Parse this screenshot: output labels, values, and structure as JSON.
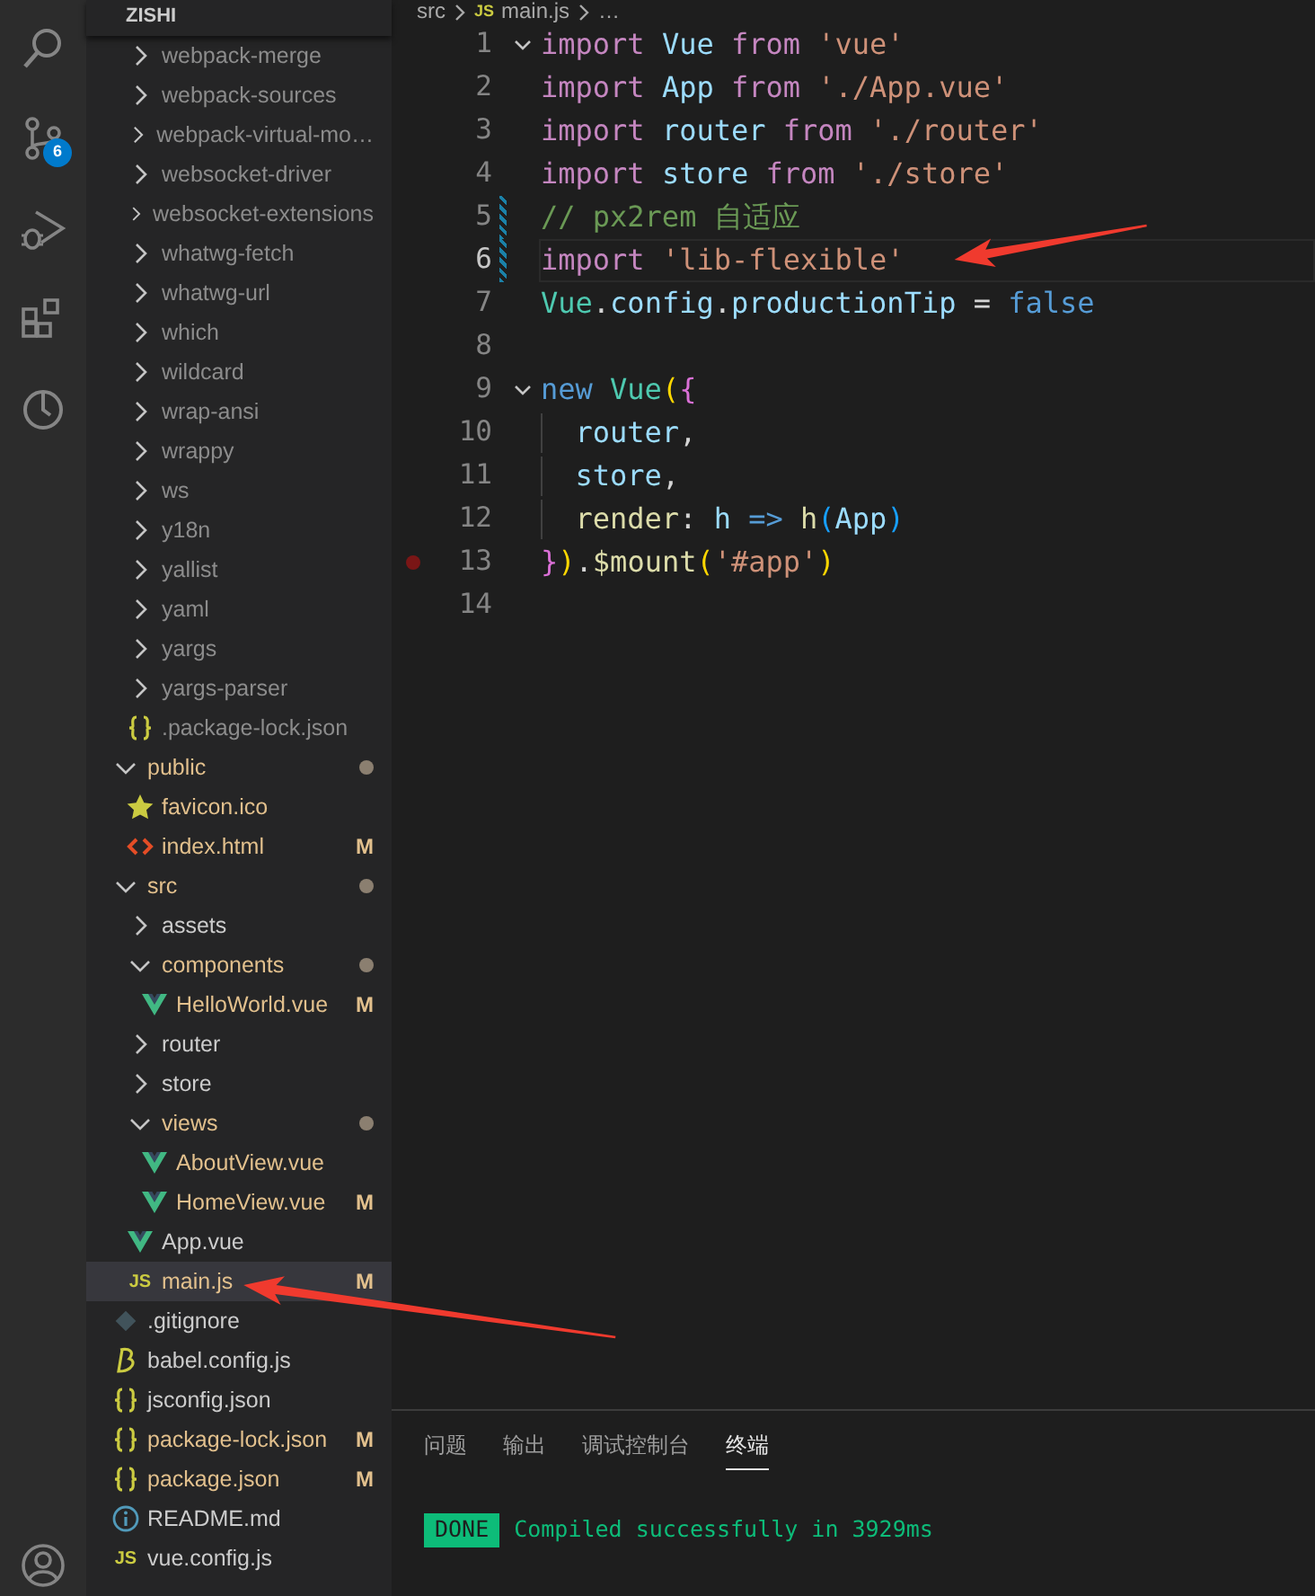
{
  "activity_bar": {
    "items": [
      {
        "kind": "search"
      },
      {
        "kind": "source-control",
        "badge": "6"
      },
      {
        "kind": "debug"
      },
      {
        "kind": "extensions"
      },
      {
        "kind": "timeline"
      }
    ],
    "account": {
      "kind": "account"
    }
  },
  "explorer": {
    "title": "ZISHI",
    "items": [
      {
        "kind": "offscreen",
        "children": [
          {
            "label": "webpack-merge",
            "kind": "folder",
            "expanded": false,
            "dimmed": true,
            "selected": false
          },
          {
            "label": "webpack-sources",
            "kind": "folder",
            "expanded": false,
            "dimmed": true,
            "selected": false
          },
          {
            "label": "webpack-virtual-mo…",
            "kind": "folder",
            "expanded": false,
            "dimmed": true,
            "selected": false
          },
          {
            "label": "websocket-driver",
            "kind": "folder",
            "expanded": false,
            "dimmed": true,
            "selected": false
          },
          {
            "label": "websocket-extensions",
            "kind": "folder",
            "expanded": false,
            "dimmed": true,
            "selected": false
          },
          {
            "label": "whatwg-fetch",
            "kind": "folder",
            "expanded": false,
            "dimmed": true,
            "selected": false
          },
          {
            "label": "whatwg-url",
            "kind": "folder",
            "expanded": false,
            "dimmed": true,
            "selected": false
          },
          {
            "label": "which",
            "kind": "folder",
            "expanded": false,
            "dimmed": true,
            "selected": false
          },
          {
            "label": "wildcard",
            "kind": "folder",
            "expanded": false,
            "dimmed": true,
            "selected": false
          },
          {
            "label": "wrap-ansi",
            "kind": "folder",
            "expanded": false,
            "dimmed": true,
            "selected": false
          },
          {
            "label": "wrappy",
            "kind": "folder",
            "expanded": false,
            "dimmed": true,
            "selected": false
          },
          {
            "label": "ws",
            "kind": "folder",
            "expanded": false,
            "dimmed": true,
            "selected": false
          },
          {
            "label": "y18n",
            "kind": "folder",
            "expanded": false,
            "dimmed": true,
            "selected": false
          },
          {
            "label": "yallist",
            "kind": "folder",
            "expanded": false,
            "dimmed": true,
            "selected": false
          },
          {
            "label": "yaml",
            "kind": "folder",
            "expanded": false,
            "dimmed": true,
            "selected": false
          },
          {
            "label": "yargs",
            "kind": "folder",
            "expanded": false,
            "dimmed": true,
            "selected": false
          },
          {
            "label": "yargs-parser",
            "kind": "folder",
            "expanded": false,
            "dimmed": true,
            "selected": false
          },
          {
            "label": ".package-lock.json",
            "kind": "json",
            "dimmed": true,
            "selected": false
          }
        ]
      },
      {
        "label": "public",
        "kind": "folder",
        "expanded": true,
        "dimmed": false,
        "modified": true,
        "dot": true,
        "selected": false,
        "children": [
          {
            "label": "favicon.ico",
            "kind": "star",
            "dimmed": false,
            "modified": true,
            "selected": false
          },
          {
            "label": "index.html",
            "kind": "html",
            "dimmed": false,
            "modified": true,
            "badge": "M",
            "selected": false
          }
        ]
      },
      {
        "label": "src",
        "kind": "folder",
        "expanded": true,
        "dimmed": false,
        "modified": true,
        "dot": true,
        "selected": false,
        "children": [
          {
            "label": "assets",
            "kind": "folder",
            "expanded": false,
            "dimmed": false,
            "modified": false,
            "selected": false
          },
          {
            "label": "components",
            "kind": "folder",
            "expanded": true,
            "dimmed": false,
            "modified": true,
            "dot": true,
            "selected": false,
            "children": [
              {
                "label": "HelloWorld.vue",
                "kind": "vue",
                "dimmed": false,
                "modified": true,
                "badge": "M",
                "selected": false
              }
            ]
          },
          {
            "label": "router",
            "kind": "folder",
            "expanded": false,
            "dimmed": false,
            "modified": false,
            "selected": false
          },
          {
            "label": "store",
            "kind": "folder",
            "expanded": false,
            "dimmed": false,
            "modified": false,
            "selected": false
          },
          {
            "label": "views",
            "kind": "folder",
            "expanded": true,
            "dimmed": false,
            "modified": true,
            "dot": true,
            "selected": false,
            "children": [
              {
                "label": "AboutView.vue",
                "kind": "vue",
                "dimmed": false,
                "modified": true,
                "selected": false
              },
              {
                "label": "HomeView.vue",
                "kind": "vue",
                "dimmed": false,
                "modified": true,
                "badge": "M",
                "selected": false
              }
            ]
          },
          {
            "label": "App.vue",
            "kind": "vue",
            "dimmed": false,
            "modified": false,
            "selected": false
          },
          {
            "label": "main.js",
            "kind": "js",
            "icon_text": "JS",
            "dimmed": false,
            "modified": true,
            "badge": "M",
            "selected": true,
            "arrow": true
          }
        ]
      },
      {
        "label": ".gitignore",
        "kind": "git",
        "dimmed": false,
        "modified": false,
        "selected": false
      },
      {
        "label": "babel.config.js",
        "kind": "babel",
        "dimmed": false,
        "modified": false,
        "selected": false
      },
      {
        "label": "jsconfig.json",
        "kind": "json",
        "dimmed": false,
        "modified": false,
        "selected": false
      },
      {
        "label": "package-lock.json",
        "kind": "json",
        "dimmed": false,
        "modified": true,
        "badge": "M",
        "selected": false
      },
      {
        "label": "package.json",
        "kind": "json",
        "dimmed": false,
        "modified": true,
        "badge": "M",
        "selected": false
      },
      {
        "label": "README.md",
        "kind": "info",
        "dimmed": false,
        "modified": false,
        "selected": false
      },
      {
        "label": "vue.config.js",
        "kind": "js",
        "icon_text": "JS",
        "dimmed": false,
        "modified": false,
        "selected": false
      }
    ]
  },
  "breadcrumb": [
    {
      "label": "src",
      "kind": "folder"
    },
    {
      "label": "main.js",
      "kind": "js",
      "icon_text": "JS"
    },
    {
      "label": "…",
      "kind": "more"
    }
  ],
  "editor": {
    "lines": [
      {
        "number": "1",
        "fold": true,
        "current": false,
        "changed": false,
        "breakpoint": false,
        "tokens": [
          {
            "text": "import ",
            "kind": "keyword"
          },
          {
            "text": "Vue ",
            "kind": "variable"
          },
          {
            "text": "from ",
            "kind": "keyword"
          },
          {
            "text": "'vue'",
            "kind": "string"
          }
        ]
      },
      {
        "number": "2",
        "fold": false,
        "current": false,
        "changed": false,
        "breakpoint": false,
        "tokens": [
          {
            "text": "import ",
            "kind": "keyword"
          },
          {
            "text": "App ",
            "kind": "variable"
          },
          {
            "text": "from ",
            "kind": "keyword"
          },
          {
            "text": "'./App.vue'",
            "kind": "string"
          }
        ]
      },
      {
        "number": "3",
        "fold": false,
        "current": false,
        "changed": false,
        "breakpoint": false,
        "tokens": [
          {
            "text": "import ",
            "kind": "keyword"
          },
          {
            "text": "router ",
            "kind": "variable"
          },
          {
            "text": "from ",
            "kind": "keyword"
          },
          {
            "text": "'./router'",
            "kind": "string"
          }
        ]
      },
      {
        "number": "4",
        "fold": false,
        "current": false,
        "changed": false,
        "breakpoint": false,
        "tokens": [
          {
            "text": "import ",
            "kind": "keyword"
          },
          {
            "text": "store ",
            "kind": "variable"
          },
          {
            "text": "from ",
            "kind": "keyword"
          },
          {
            "text": "'./store'",
            "kind": "string"
          }
        ]
      },
      {
        "number": "5",
        "fold": false,
        "current": false,
        "changed": true,
        "breakpoint": false,
        "tokens": [
          {
            "text": "// px2rem 自适应",
            "kind": "comment"
          }
        ]
      },
      {
        "number": "6",
        "fold": false,
        "current": true,
        "changed": true,
        "breakpoint": false,
        "arrow": true,
        "tokens": [
          {
            "text": "import ",
            "kind": "keyword"
          },
          {
            "text": "'lib-flexible'",
            "kind": "string"
          }
        ]
      },
      {
        "number": "7",
        "fold": false,
        "current": false,
        "changed": false,
        "breakpoint": false,
        "tokens": [
          {
            "text": "Vue",
            "kind": "class"
          },
          {
            "text": ".",
            "kind": "plain"
          },
          {
            "text": "config",
            "kind": "variable"
          },
          {
            "text": ".",
            "kind": "plain"
          },
          {
            "text": "productionTip",
            "kind": "variable"
          },
          {
            "text": " = ",
            "kind": "plain"
          },
          {
            "text": "false",
            "kind": "storage"
          }
        ]
      },
      {
        "number": "8",
        "fold": false,
        "current": false,
        "changed": false,
        "breakpoint": false
      },
      {
        "number": "9",
        "fold": true,
        "current": false,
        "changed": false,
        "breakpoint": false,
        "tokens": [
          {
            "text": "new ",
            "kind": "storage"
          },
          {
            "text": "Vue",
            "kind": "class"
          },
          {
            "text": "(",
            "kind": "bracket1"
          },
          {
            "text": "{",
            "kind": "bracket2"
          }
        ]
      },
      {
        "number": "10",
        "fold": false,
        "current": false,
        "changed": false,
        "breakpoint": false,
        "tokens": [
          {
            "text": "  router",
            "kind": "variable"
          },
          {
            "text": ",",
            "kind": "plain"
          }
        ]
      },
      {
        "number": "11",
        "fold": false,
        "current": false,
        "changed": false,
        "breakpoint": false,
        "tokens": [
          {
            "text": "  store",
            "kind": "variable"
          },
          {
            "text": ",",
            "kind": "plain"
          }
        ]
      },
      {
        "number": "12",
        "fold": false,
        "current": false,
        "changed": false,
        "breakpoint": false,
        "tokens": [
          {
            "text": "  render",
            "kind": "function"
          },
          {
            "text": ": ",
            "kind": "plain"
          },
          {
            "text": "h ",
            "kind": "variable"
          },
          {
            "text": "=> ",
            "kind": "storage"
          },
          {
            "text": "h",
            "kind": "function"
          },
          {
            "text": "(",
            "kind": "bracket3"
          },
          {
            "text": "App",
            "kind": "variable"
          },
          {
            "text": ")",
            "kind": "bracket3"
          }
        ]
      },
      {
        "number": "13",
        "fold": false,
        "current": false,
        "changed": false,
        "breakpoint": true,
        "tokens": [
          {
            "text": "}",
            "kind": "bracket2"
          },
          {
            "text": ")",
            "kind": "bracket1"
          },
          {
            "text": ".",
            "kind": "plain"
          },
          {
            "text": "$mount",
            "kind": "function"
          },
          {
            "text": "(",
            "kind": "bracket1"
          },
          {
            "text": "'#app'",
            "kind": "string"
          },
          {
            "text": ")",
            "kind": "bracket1"
          }
        ]
      },
      {
        "number": "14",
        "fold": false,
        "current": false,
        "changed": false,
        "breakpoint": false
      }
    ]
  },
  "panel": {
    "tabs": [
      {
        "label": "问题",
        "selected": false
      },
      {
        "label": "输出",
        "selected": false
      },
      {
        "label": "调试控制台",
        "selected": false
      },
      {
        "label": "终端",
        "selected": true
      }
    ],
    "terminal": {
      "badge": "DONE",
      "message": "Compiled successfully in 3929ms"
    }
  }
}
